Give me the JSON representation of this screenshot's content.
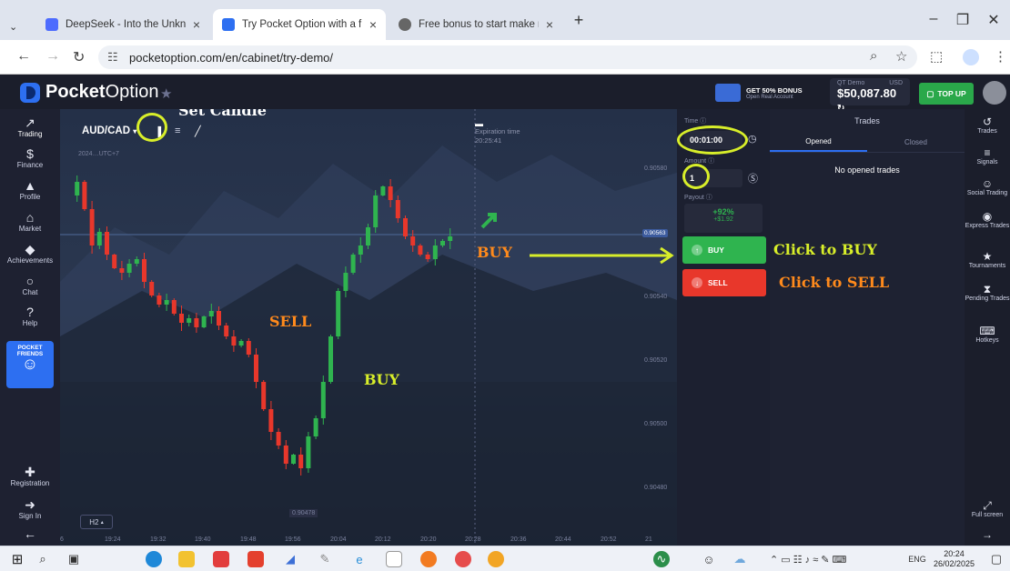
{
  "browser": {
    "tabs": [
      {
        "title": "DeepSeek - Into the Unknown",
        "close": "×"
      },
      {
        "title": "Try Pocket Option with a free d…",
        "close": "×"
      },
      {
        "title": "Free bonus to start make mone…",
        "close": "×"
      }
    ],
    "new_tab": "+",
    "url": "pocketoption.com/en/cabinet/try-demo/",
    "window": {
      "minimize": "–",
      "restore": "❐",
      "close": "✕"
    }
  },
  "app": {
    "logo_bold": "Pocket",
    "logo_rest": "Option",
    "bonus": {
      "line1": "GET 50% BONUS",
      "line2": "Open Real Account"
    },
    "balance": {
      "label_left": "QT Demo",
      "label_right": "USD",
      "amount": "$50,087.80"
    },
    "topup_label": "TOP UP",
    "left_nav": [
      {
        "icon": "↗",
        "label": "Trading"
      },
      {
        "icon": "$",
        "label": "Finance"
      },
      {
        "icon": "▲",
        "label": "Profile"
      },
      {
        "icon": "⌂",
        "label": "Market"
      },
      {
        "icon": "◆",
        "label": "Achievements"
      },
      {
        "icon": "○",
        "label": "Chat"
      },
      {
        "icon": "?",
        "label": "Help"
      }
    ],
    "pocket_friends": "POCKET FRIENDS",
    "left_bottom": [
      {
        "icon": "✚",
        "label": "Registration"
      },
      {
        "icon": "➜",
        "label": "Sign In"
      },
      {
        "icon": "←",
        "label": ""
      }
    ],
    "chart": {
      "pair": "AUD/CAD",
      "timezone": "2024…UTC+7",
      "expiration_label": "Expiration time",
      "expiration_value": "20:25:41",
      "timeframe": "H2",
      "current_price": "0.90563",
      "low_price": "0.90478",
      "price_ticks": [
        "0.90580",
        "0.90540",
        "0.90520",
        "0.90500",
        "0.90480"
      ],
      "time_ticks": [
        "6",
        "19:24",
        "19:32",
        "19:40",
        "19:48",
        "19:56",
        "20:04",
        "20:12",
        "20:20",
        "20:28",
        "20:36",
        "20:44",
        "20:52",
        "21"
      ]
    },
    "annotations": {
      "set_candle": "Set Candle",
      "sell": "SELL",
      "buy_low": "BUY",
      "buy_right": "BUY",
      "click_buy": "Click to BUY",
      "click_sell": "Click to SELL"
    },
    "trade_panel": {
      "time_label": "Time ⓘ",
      "time_value": "00:01:00",
      "amount_label": "Amount ⓘ",
      "amount_value": "1",
      "payout_label": "Payout ⓘ",
      "payout_pct": "+92%",
      "payout_amt": "+$1.92",
      "buy_label": "BUY",
      "sell_label": "SELL"
    },
    "trades": {
      "title": "Trades",
      "tab_opened": "Opened",
      "tab_closed": "Closed",
      "empty": "No opened trades"
    },
    "right_nav": [
      {
        "icon": "↺",
        "label": "Trades"
      },
      {
        "icon": "≡",
        "label": "Signals"
      },
      {
        "icon": "☺",
        "label": "Social Trading"
      },
      {
        "icon": "◉",
        "label": "Express Trades"
      },
      {
        "icon": "★",
        "label": "Tournaments"
      },
      {
        "icon": "⧗",
        "label": "Pending Trades"
      },
      {
        "icon": "⌨",
        "label": "Hotkeys"
      }
    ],
    "fullscreen": "Full screen"
  },
  "taskbar": {
    "lang": "ENG",
    "time": "20:24",
    "date": "26/02/2025"
  },
  "colors": {
    "buy": "#2fb44f",
    "sell": "#e8372b",
    "accent": "#2d6ff1",
    "annotation_yellow": "#d8ee2a"
  }
}
